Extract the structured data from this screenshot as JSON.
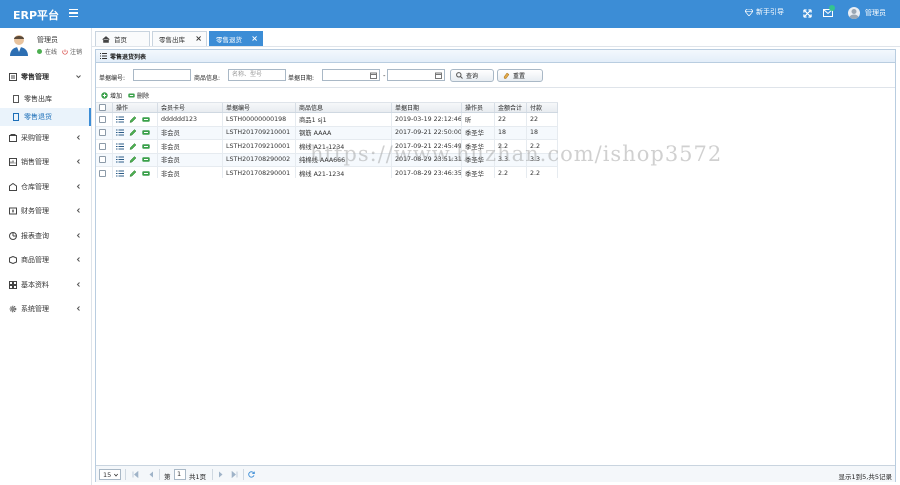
{
  "app": {
    "brand": "ERP平台"
  },
  "topbar": {
    "guide": "新手引导",
    "user": "管理员"
  },
  "sidebar": {
    "user_name": "管理员",
    "status": "在线",
    "logout": "注销",
    "menu": [
      {
        "label": "零售管理",
        "icon": "cart-icon"
      },
      {
        "label": "采购管理",
        "icon": "purchase-icon"
      },
      {
        "label": "销售管理",
        "icon": "sales-icon"
      },
      {
        "label": "仓库管理",
        "icon": "warehouse-icon"
      },
      {
        "label": "财务管理",
        "icon": "finance-icon"
      },
      {
        "label": "报表查询",
        "icon": "report-icon"
      },
      {
        "label": "商品管理",
        "icon": "goods-icon"
      },
      {
        "label": "基本资料",
        "icon": "profile-icon"
      },
      {
        "label": "系统管理",
        "icon": "system-icon"
      }
    ],
    "sub": [
      {
        "label": "零售出库"
      },
      {
        "label": "零售退货"
      }
    ]
  },
  "tabs": [
    {
      "label": "首页"
    },
    {
      "label": "零售出库"
    },
    {
      "label": "零售退货"
    }
  ],
  "panel": {
    "title": "零售退货列表"
  },
  "search": {
    "doc_no_label": "单据编号:",
    "goods_label": "商品信息:",
    "goods_placeholder": "名称、型号",
    "date_label": "单据日期:",
    "range_sep": "-",
    "query": "查询",
    "reset": "重置"
  },
  "toolbar": {
    "add": "增加",
    "delete": "删除"
  },
  "grid": {
    "headers": [
      "操作",
      "会员卡号",
      "单据编号",
      "商品信息",
      "单据日期",
      "操作员",
      "金额合计",
      "付款"
    ],
    "rows": [
      [
        "dddddd123",
        "LSTH00000000198",
        "商品1 sj1",
        "2019-03-19 22:12:46",
        "昕",
        "22",
        "22"
      ],
      [
        "非会员",
        "LSTH201709210001",
        "钢筋 AAAA",
        "2017-09-21 22:50:00",
        "季圣华",
        "18",
        "18"
      ],
      [
        "非会员",
        "LSTH201709210001",
        "棉线 A21-1234",
        "2017-09-21 22:45:49",
        "季圣华",
        "2.2",
        "2.2"
      ],
      [
        "非会员",
        "LSTH201708290002",
        "纯棉线 AAA666",
        "2017-08-29 23:51:31",
        "季圣华",
        "3.3",
        "3.3"
      ],
      [
        "非会员",
        "LSTH201708290001",
        "棉线 A21-1234",
        "2017-08-29 23:46:35",
        "季圣华",
        "2.2",
        "2.2"
      ]
    ]
  },
  "pager": {
    "page_size": "15",
    "page_prefix": "第",
    "page_no": "1",
    "page_total": "共1页",
    "info": "显示1到5,共5记录"
  },
  "watermark": "https://www.huzhan.com/ishop3572"
}
